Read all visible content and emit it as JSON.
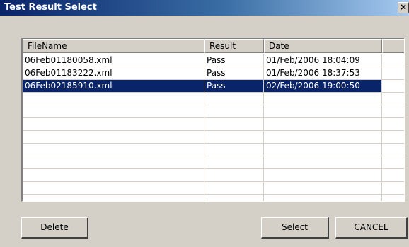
{
  "window": {
    "title": "Test Result Select",
    "close_glyph": "×"
  },
  "list": {
    "columns": [
      "FileName",
      "Result",
      "Date",
      ""
    ],
    "rows": [
      {
        "file": "06Feb01180058.xml",
        "result": "Pass",
        "date": "01/Feb/2006 18:04:09"
      },
      {
        "file": "06Feb01183222.xml",
        "result": "Pass",
        "date": "01/Feb/2006 18:37:53"
      },
      {
        "file": "06Feb02185910.xml",
        "result": "Pass",
        "date": "02/Feb/2006 19:00:50"
      }
    ],
    "selected_row_index": 2
  },
  "buttons": {
    "delete": "Delete",
    "select": "Select",
    "cancel": "CANCEL"
  },
  "colors": {
    "selection_bg": "#0a246a",
    "title_gradient_start": "#0a246a",
    "face": "#d4d0c8"
  }
}
